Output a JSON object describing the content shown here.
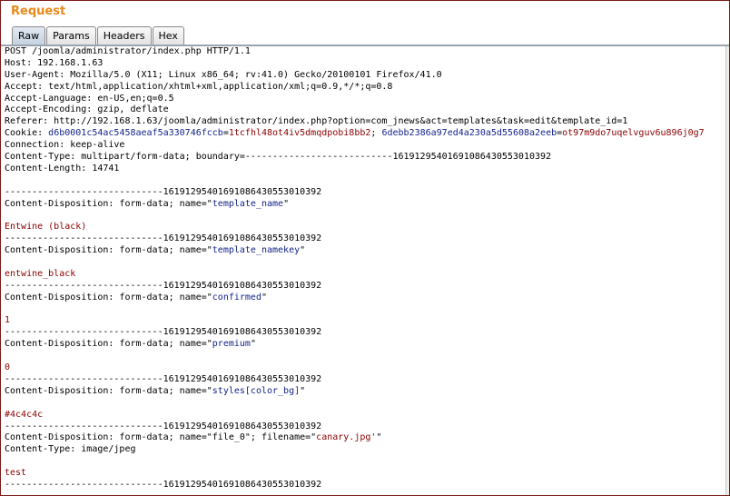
{
  "panel": {
    "title": "Request"
  },
  "tabs": [
    {
      "label": "Raw",
      "active": true
    },
    {
      "label": "Params",
      "active": false
    },
    {
      "label": "Headers",
      "active": false
    },
    {
      "label": "Hex",
      "active": false
    }
  ],
  "colors": {
    "title": "#e8891a",
    "blue_value": "#14248a",
    "red_value": "#8b0000",
    "frame": "#7a1a1a"
  },
  "request": {
    "lines": [
      {
        "segments": [
          {
            "text": "POST /joomla/administrator/index.php HTTP/1.1",
            "style": "plain"
          }
        ]
      },
      {
        "segments": [
          {
            "text": "Host: 192.168.1.63",
            "style": "plain"
          }
        ]
      },
      {
        "segments": [
          {
            "text": "User-Agent: Mozilla/5.0 (X11; Linux x86_64; rv:41.0) Gecko/20100101 Firefox/41.0",
            "style": "plain"
          }
        ]
      },
      {
        "segments": [
          {
            "text": "Accept: text/html,application/xhtml+xml,application/xml;q=0.9,*/*;q=0.8",
            "style": "plain"
          }
        ]
      },
      {
        "segments": [
          {
            "text": "Accept-Language: en-US,en;q=0.5",
            "style": "plain"
          }
        ]
      },
      {
        "segments": [
          {
            "text": "Accept-Encoding: gzip, deflate",
            "style": "plain"
          }
        ]
      },
      {
        "segments": [
          {
            "text": "Referer: http://192.168.1.63/joomla/administrator/index.php?option=com_jnews&act=templates&task=edit&template_id=1",
            "style": "plain"
          }
        ]
      },
      {
        "segments": [
          {
            "text": "Cookie: ",
            "style": "plain"
          },
          {
            "text": "d6b0001c54ac5458aeaf5a330746fccb",
            "style": "blue"
          },
          {
            "text": "=",
            "style": "plain"
          },
          {
            "text": "1tcfhl48ot4iv5dmqdpobi8bb2",
            "style": "red"
          },
          {
            "text": "; ",
            "style": "plain"
          },
          {
            "text": "6debb2386a97ed4a230a5d55608a2eeb",
            "style": "blue"
          },
          {
            "text": "=",
            "style": "plain"
          },
          {
            "text": "ot97m9do7uqelvguv6u896j0g7",
            "style": "red"
          }
        ]
      },
      {
        "segments": [
          {
            "text": "Connection: keep-alive",
            "style": "plain"
          }
        ]
      },
      {
        "segments": [
          {
            "text": "Content-Type: multipart/form-data; boundary=---------------------------16191295401691086430553010392",
            "style": "plain"
          }
        ]
      },
      {
        "segments": [
          {
            "text": "Content-Length: 14741",
            "style": "plain"
          }
        ]
      },
      {
        "segments": [
          {
            "text": "",
            "style": "plain"
          }
        ]
      },
      {
        "segments": [
          {
            "text": "-----------------------------16191295401691086430553010392",
            "style": "plain"
          }
        ]
      },
      {
        "segments": [
          {
            "text": "Content-Disposition: form-data; name=\"",
            "style": "plain"
          },
          {
            "text": "template_name",
            "style": "blue"
          },
          {
            "text": "\"",
            "style": "plain"
          }
        ]
      },
      {
        "segments": [
          {
            "text": "",
            "style": "plain"
          }
        ]
      },
      {
        "segments": [
          {
            "text": "Entwine (black)",
            "style": "red"
          }
        ]
      },
      {
        "segments": [
          {
            "text": "-----------------------------16191295401691086430553010392",
            "style": "plain"
          }
        ]
      },
      {
        "segments": [
          {
            "text": "Content-Disposition: form-data; name=\"",
            "style": "plain"
          },
          {
            "text": "template_namekey",
            "style": "blue"
          },
          {
            "text": "\"",
            "style": "plain"
          }
        ]
      },
      {
        "segments": [
          {
            "text": "",
            "style": "plain"
          }
        ]
      },
      {
        "segments": [
          {
            "text": "entwine_black",
            "style": "red"
          }
        ]
      },
      {
        "segments": [
          {
            "text": "-----------------------------16191295401691086430553010392",
            "style": "plain"
          }
        ]
      },
      {
        "segments": [
          {
            "text": "Content-Disposition: form-data; name=\"",
            "style": "plain"
          },
          {
            "text": "confirmed",
            "style": "blue"
          },
          {
            "text": "\"",
            "style": "plain"
          }
        ]
      },
      {
        "segments": [
          {
            "text": "",
            "style": "plain"
          }
        ]
      },
      {
        "segments": [
          {
            "text": "1",
            "style": "red"
          }
        ]
      },
      {
        "segments": [
          {
            "text": "-----------------------------16191295401691086430553010392",
            "style": "plain"
          }
        ]
      },
      {
        "segments": [
          {
            "text": "Content-Disposition: form-data; name=\"",
            "style": "plain"
          },
          {
            "text": "premium",
            "style": "blue"
          },
          {
            "text": "\"",
            "style": "plain"
          }
        ]
      },
      {
        "segments": [
          {
            "text": "",
            "style": "plain"
          }
        ]
      },
      {
        "segments": [
          {
            "text": "0",
            "style": "red"
          }
        ]
      },
      {
        "segments": [
          {
            "text": "-----------------------------16191295401691086430553010392",
            "style": "plain"
          }
        ]
      },
      {
        "segments": [
          {
            "text": "Content-Disposition: form-data; name=\"",
            "style": "plain"
          },
          {
            "text": "styles[color_bg]",
            "style": "blue"
          },
          {
            "text": "\"",
            "style": "plain"
          }
        ]
      },
      {
        "segments": [
          {
            "text": "",
            "style": "plain"
          }
        ]
      },
      {
        "segments": [
          {
            "text": "#4c4c4c",
            "style": "red"
          }
        ]
      },
      {
        "segments": [
          {
            "text": "-----------------------------16191295401691086430553010392",
            "style": "plain"
          }
        ]
      },
      {
        "segments": [
          {
            "text": "Content-Disposition: form-data; name=\"file_0\"; filename=\"",
            "style": "plain"
          },
          {
            "text": "canary.jpg'",
            "style": "red"
          },
          {
            "text": "\"",
            "style": "plain"
          }
        ]
      },
      {
        "segments": [
          {
            "text": "Content-Type: image/jpeg",
            "style": "plain"
          }
        ]
      },
      {
        "segments": [
          {
            "text": "",
            "style": "plain"
          }
        ]
      },
      {
        "segments": [
          {
            "text": "test",
            "style": "red"
          }
        ]
      },
      {
        "segments": [
          {
            "text": "-----------------------------16191295401691086430553010392",
            "style": "plain"
          }
        ]
      }
    ]
  }
}
